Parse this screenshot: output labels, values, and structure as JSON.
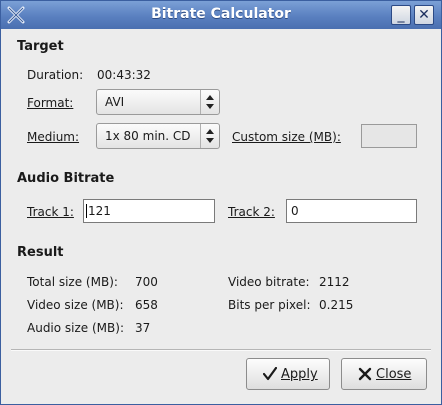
{
  "window": {
    "title": "Bitrate Calculator",
    "minimize": "_",
    "close": "✕"
  },
  "target": {
    "heading": "Target",
    "duration_label": "Duration:",
    "duration_value": "00:43:32",
    "format_label": "Format:",
    "format_value": "AVI",
    "medium_label": "Medium:",
    "medium_value": "1x 80 min. CD",
    "custom_size_label": "Custom size (MB):",
    "custom_size_value": ""
  },
  "audio": {
    "heading": "Audio Bitrate",
    "track1_label": "Track 1:",
    "track1_value": "121",
    "track2_label": "Track 2:",
    "track2_value": "0"
  },
  "result": {
    "heading": "Result",
    "total_size_label": "Total size (MB):",
    "total_size_value": "700",
    "video_size_label": "Video size (MB):",
    "video_size_value": "658",
    "audio_size_label": "Audio size (MB):",
    "audio_size_value": "37",
    "video_bitrate_label": "Video bitrate:",
    "video_bitrate_value": "2112",
    "bpp_label": "Bits per pixel:",
    "bpp_value": "0.215"
  },
  "buttons": {
    "apply": "Apply",
    "close": "Close"
  }
}
